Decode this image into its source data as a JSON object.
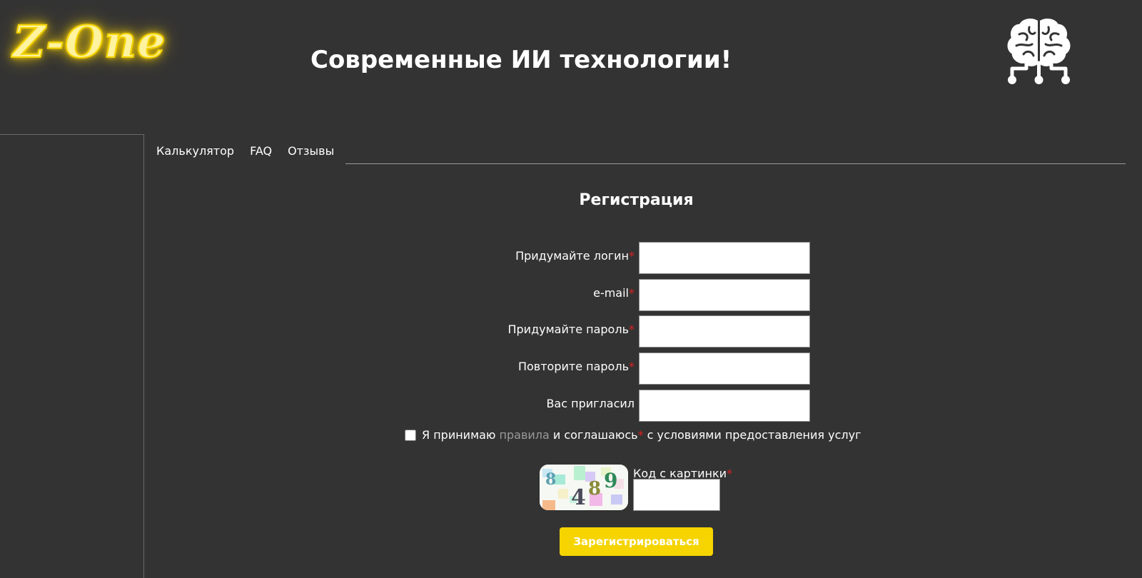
{
  "header": {
    "logo_text": "Z-One",
    "title": "Современные ИИ технологии!",
    "brain_icon": "brain-circuit-icon"
  },
  "nav": {
    "items": [
      {
        "label": "Калькулятор"
      },
      {
        "label": "FAQ"
      },
      {
        "label": "Отзывы"
      }
    ]
  },
  "form": {
    "title": "Регистрация",
    "required_mark": "*",
    "fields": [
      {
        "label": "Придумайте логин",
        "required": true,
        "value": ""
      },
      {
        "label": "e-mail",
        "required": true,
        "value": ""
      },
      {
        "label": "Придумайте пароль",
        "required": true,
        "value": ""
      },
      {
        "label": "Повторите пароль",
        "required": true,
        "value": ""
      },
      {
        "label": "Вас пригласил",
        "required": false,
        "value": ""
      }
    ],
    "agree": {
      "prefix": "Я принимаю",
      "link": "правила",
      "middle": "и соглашаюсь",
      "suffix": "с условиями предоставления услуг",
      "checked": false
    },
    "captcha": {
      "digits": [
        "8",
        "4",
        "8",
        "9"
      ],
      "label": "Код с картинки",
      "value": ""
    },
    "submit_label": "Зарегистрироваться"
  },
  "colors": {
    "background": "#333333",
    "accent": "#f5d400",
    "required": "#e02020",
    "link_muted": "#9a9a9a"
  }
}
